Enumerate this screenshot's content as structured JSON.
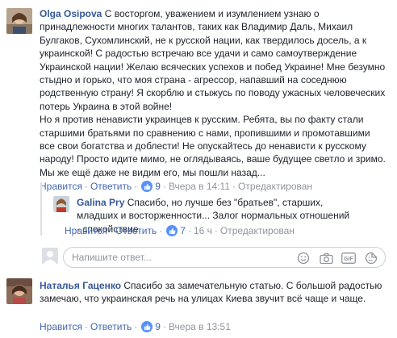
{
  "comments": [
    {
      "author": "Olga Osipova",
      "text": "С восторгом, уважением и изумлением узнаю о принадлежности многих талантов, таких как Владимир Даль, Михаил Булгаков, Сухомлинский, не к русской нации, как твердилось досель, а к украинской! С радостью встречаю все удачи и само самоутверждение Украинской нации! Желаю всяческих успехов и побед Украине! Мне безумно стыдно и горько, что моя страна - агрессор, напавший на соседнюю родственную страну! Я скорблю и стыжусь по поводу ужасных человеческих потерь Украина в этой войне!\nНо я против ненависти украинцев к русским. Ребята, вы по факту стали старшими братьями по сравнению с нами, пропившими и промотавшими все свои богатства и доблести! Не опускайтесь до ненависти к русскому народу! Просто идите мимо, не оглядываясь, ваше будущее светло и зримо. Мы же ещё даже не видим его, мы пошли назад...",
      "like_label": "Нравится",
      "reply_label": "Ответить",
      "likes": "9",
      "time": "Вчера в 14:11",
      "edited": "Отредактирован"
    },
    {
      "author": "Galina Pry",
      "text": "Спасибо, но лучше без \"братьев\", старших, младших и восторженности... Залог нормальных отношений - спокойствие.",
      "like_label": "Нравится",
      "reply_label": "Ответить",
      "likes": "7",
      "time": "16 ч",
      "edited": "Отредактирован"
    },
    {
      "author": "Наталья Гаценко",
      "text": "Спасибо за замечательную статью. С большой радостью замечаю, что украинская речь на улицах Киева звучит всё чаще и чаще.",
      "like_label": "Нравится",
      "reply_label": "Ответить",
      "likes": "9",
      "time": "Вчера в 13:51"
    }
  ],
  "reply_box": {
    "placeholder": "Напишите ответ..."
  },
  "icons": {
    "like": "like-thumb-icon",
    "emoji": "emoji-icon",
    "camera": "camera-icon",
    "gif": "gif-icon",
    "sticker": "sticker-icon"
  },
  "colors": {
    "link": "#365899",
    "action": "#4267b2",
    "meta": "#90949c",
    "like_badge": "#5890ff"
  }
}
